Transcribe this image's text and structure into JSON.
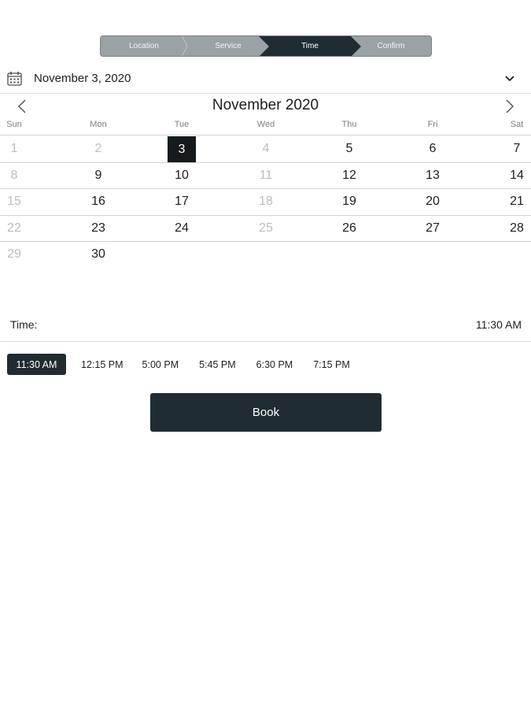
{
  "stepper": {
    "steps": [
      {
        "label": "Location",
        "active": false
      },
      {
        "label": "Service",
        "active": false
      },
      {
        "label": "Time",
        "active": true
      },
      {
        "label": "Confirm",
        "active": false
      }
    ],
    "active_color": "#1f2d33",
    "inactive_color": "#9aa2a6"
  },
  "date_picker": {
    "icon": "calendar-icon",
    "selected_date_text": "November 3, 2020",
    "toggle_icon": "chevron-down-icon"
  },
  "calendar": {
    "month_title": "November 2020",
    "prev_icon": "chevron-left-icon",
    "next_icon": "chevron-right-icon",
    "weekdays": [
      "Sun",
      "Mon",
      "Tue",
      "Wed",
      "Thu",
      "Fri",
      "Sat"
    ],
    "weeks": [
      [
        {
          "d": "1",
          "m": true
        },
        {
          "d": "2",
          "m": true
        },
        {
          "d": "3",
          "sel": true
        },
        {
          "d": "4",
          "m": true
        },
        {
          "d": "5"
        },
        {
          "d": "6"
        },
        {
          "d": "7"
        }
      ],
      [
        {
          "d": "8",
          "m": true
        },
        {
          "d": "9"
        },
        {
          "d": "10"
        },
        {
          "d": "11",
          "m": true
        },
        {
          "d": "12"
        },
        {
          "d": "13"
        },
        {
          "d": "14"
        }
      ],
      [
        {
          "d": "15",
          "m": true
        },
        {
          "d": "16"
        },
        {
          "d": "17"
        },
        {
          "d": "18",
          "m": true
        },
        {
          "d": "19"
        },
        {
          "d": "20"
        },
        {
          "d": "21"
        }
      ],
      [
        {
          "d": "22",
          "m": true
        },
        {
          "d": "23"
        },
        {
          "d": "24"
        },
        {
          "d": "25",
          "m": true
        },
        {
          "d": "26"
        },
        {
          "d": "27"
        },
        {
          "d": "28"
        }
      ],
      [
        {
          "d": "29",
          "m": true
        },
        {
          "d": "30"
        }
      ]
    ],
    "selected_color": "#151a1c",
    "muted_color": "#b9bdc0"
  },
  "time": {
    "label": "Time:",
    "value": "11:30 AM",
    "slots": [
      "11:30 AM",
      "12:15 PM",
      "5:00 PM",
      "5:45 PM",
      "6:30 PM",
      "7:15 PM"
    ],
    "selected_index": 0
  },
  "book_button": {
    "label": "Book",
    "color": "#1f2d33"
  }
}
